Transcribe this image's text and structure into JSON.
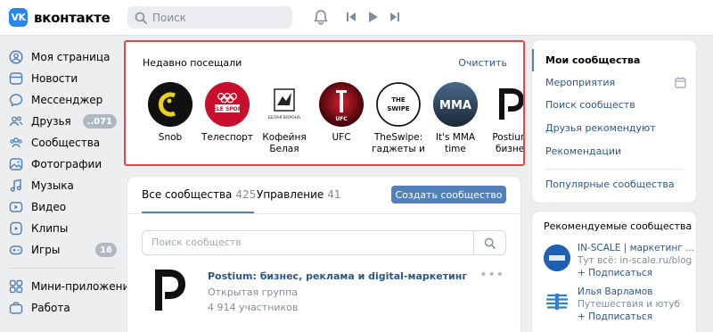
{
  "header": {
    "logo_mark": "VK",
    "logo_text": "вконтакте",
    "search_placeholder": "Поиск"
  },
  "nav": {
    "items": [
      {
        "label": "Моя страница",
        "icon": "user-circle-icon"
      },
      {
        "label": "Новости",
        "icon": "news-icon"
      },
      {
        "label": "Мессенджер",
        "icon": "message-icon"
      },
      {
        "label": "Друзья",
        "icon": "friends-icon",
        "badge": "..071"
      },
      {
        "label": "Сообщества",
        "icon": "communities-icon"
      },
      {
        "label": "Фотографии",
        "icon": "photo-icon"
      },
      {
        "label": "Музыка",
        "icon": "music-icon"
      },
      {
        "label": "Видео",
        "icon": "video-icon"
      },
      {
        "label": "Клипы",
        "icon": "clips-icon"
      },
      {
        "label": "Игры",
        "icon": "games-icon",
        "badge": "16"
      }
    ],
    "extra": [
      {
        "label": "Мини-приложения",
        "icon": "apps-icon"
      },
      {
        "label": "Работа",
        "icon": "work-icon"
      }
    ]
  },
  "recent": {
    "title": "Недавно посещали",
    "clear_label": "Очистить",
    "items": [
      {
        "name": "Snob",
        "logo_text": "",
        "bg": "#111111"
      },
      {
        "name": "Телеспорт",
        "logo_text": "TELE SPORT",
        "bg": "#c8102e"
      },
      {
        "name": "Кофейня Белая",
        "logo_text": "БЕЛАЯ ВОРОНА",
        "bg": "#ffffff"
      },
      {
        "name": "UFC",
        "logo_text": "UFC",
        "bg": "#b3122a"
      },
      {
        "name": "TheSwipe: гаджеты и",
        "logo_text": "THE SWIPE",
        "bg": "#ffffff"
      },
      {
        "name": "It's MMA time",
        "logo_text": "MMA",
        "bg": "#2a3a52"
      },
      {
        "name": "Postium: бизнес",
        "logo_text": "",
        "bg": "#ffffff"
      }
    ]
  },
  "communities": {
    "tab_all": "Все сообщества",
    "tab_all_count": "425",
    "tab_manage": "Управление",
    "tab_manage_count": "41",
    "create_label": "Создать сообщество",
    "search_placeholder": "Поиск сообществ",
    "row": {
      "name": "Postium: бизнес, реклама и digital-маркетинг",
      "type": "Открытая группа",
      "members": "4 914 участников",
      "more": "•••"
    }
  },
  "right_menu": {
    "items": [
      {
        "label": "Мои сообщества",
        "active": true
      },
      {
        "label": "Мероприятия",
        "active": false
      },
      {
        "label": "Поиск сообществ",
        "active": false
      },
      {
        "label": "Друзья рекомендуют",
        "active": false
      },
      {
        "label": "Рекомендации",
        "active": false
      }
    ],
    "popular": "Популярные сообщества"
  },
  "recommended": {
    "title": "Рекомендуемые сообщества",
    "items": [
      {
        "name": "IN-SCALE | маркетинг ...",
        "desc": "Тут всё: in-scale.ru/blog",
        "sub": "+ Подписаться"
      },
      {
        "name": "Илья Варламов",
        "desc": "Путешествия и ютуб",
        "sub": "+ Подписаться"
      }
    ]
  },
  "colors": {
    "accent": "#5181b8",
    "link": "#2a5885",
    "highlight_border": "#e64646",
    "background": "#edeef0"
  }
}
